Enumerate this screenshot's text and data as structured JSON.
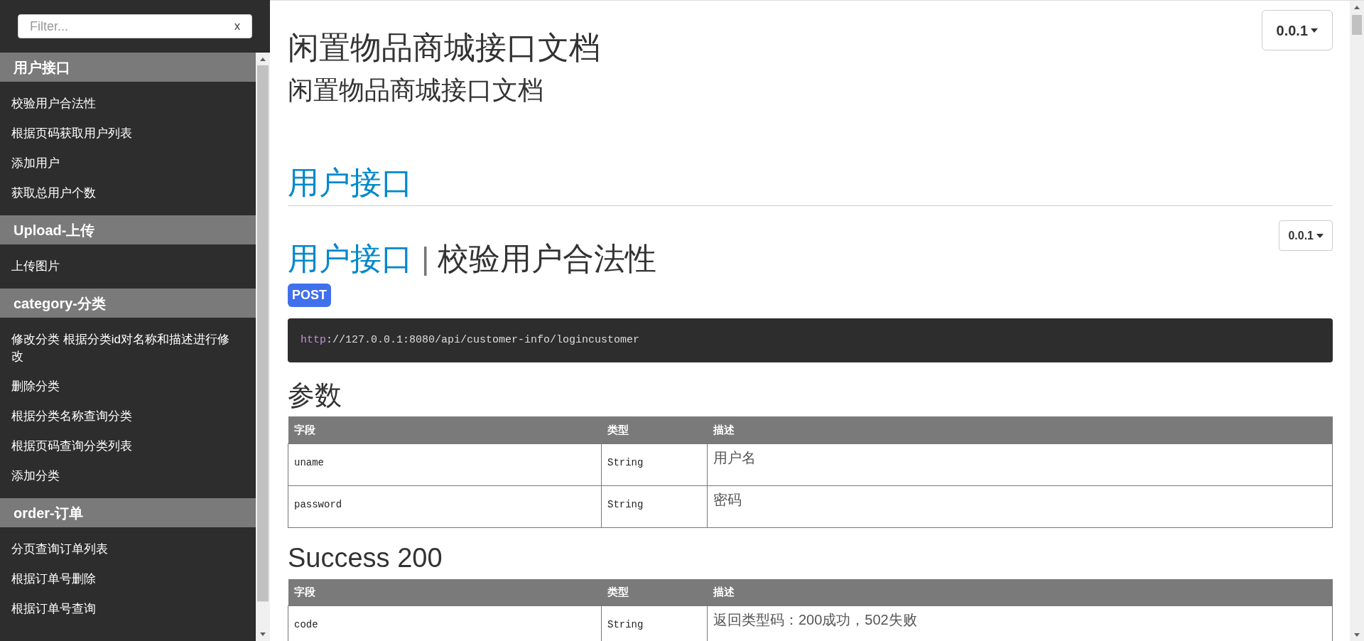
{
  "sidebar": {
    "filter": {
      "placeholder": "Filter...",
      "clear": "x"
    },
    "groups": [
      {
        "title": "用户接口",
        "items": [
          {
            "label": "校验用户合法性"
          },
          {
            "label": "根据页码获取用户列表"
          },
          {
            "label": "添加用户"
          },
          {
            "label": "获取总用户个数"
          }
        ]
      },
      {
        "title": "Upload-上传",
        "items": [
          {
            "label": "上传图片"
          }
        ]
      },
      {
        "title": "category-分类",
        "items": [
          {
            "label": "修改分类 根据分类id对名称和描述进行修改"
          },
          {
            "label": "删除分类"
          },
          {
            "label": "根据分类名称查询分类"
          },
          {
            "label": "根据页码查询分类列表"
          },
          {
            "label": "添加分类"
          }
        ]
      },
      {
        "title": "order-订单",
        "items": [
          {
            "label": "分页查询订单列表"
          },
          {
            "label": "根据订单号删除"
          },
          {
            "label": "根据订单号查询"
          }
        ]
      }
    ]
  },
  "header": {
    "title": "闲置物品商城接口文档",
    "subtitle": "闲置物品商城接口文档",
    "version": "0.0.1"
  },
  "section": {
    "title": "用户接口"
  },
  "endpoint": {
    "group": "用户接口",
    "separator": "|",
    "name": "校验用户合法性",
    "version": "0.0.1",
    "method": "POST",
    "url": {
      "scheme": "http",
      "rest": "://127.0.0.1:8080/api/customer-info/logincustomer"
    }
  },
  "params": {
    "title": "参数",
    "columns": [
      "字段",
      "类型",
      "描述"
    ],
    "rows": [
      {
        "field": "uname",
        "type": "String",
        "desc": "用户名"
      },
      {
        "field": "password",
        "type": "String",
        "desc": "密码"
      }
    ]
  },
  "success": {
    "title": "Success 200",
    "columns": [
      "字段",
      "类型",
      "描述"
    ],
    "rows": [
      {
        "field": "code",
        "type": "String",
        "desc": "返回类型码：200成功，502失败"
      }
    ]
  }
}
